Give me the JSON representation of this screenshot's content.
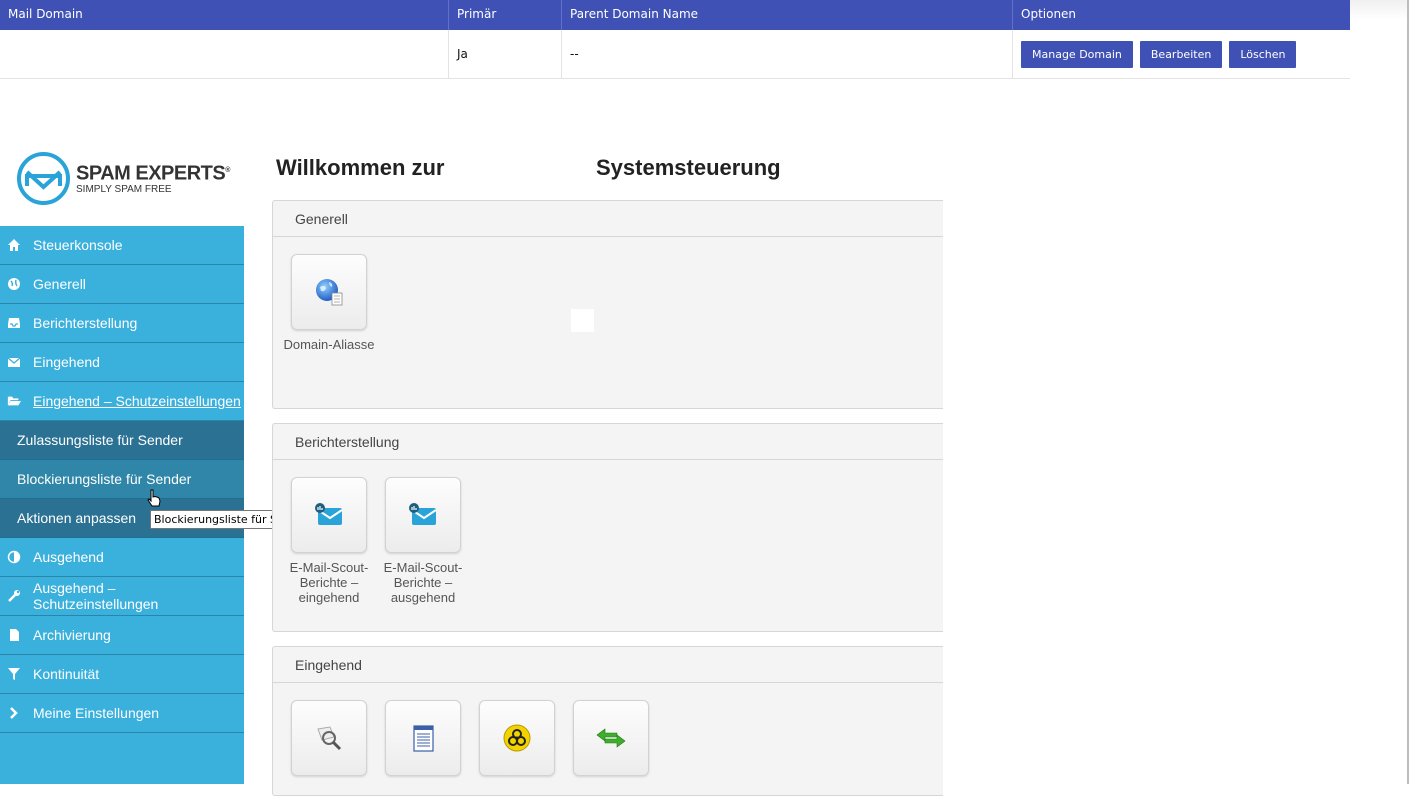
{
  "domain_table": {
    "headers": [
      "Mail Domain",
      "Primär",
      "Parent Domain Name",
      "Optionen"
    ],
    "row": {
      "mail_domain": "",
      "primary": "Ja",
      "parent": "--"
    },
    "buttons": {
      "manage": "Manage Domain",
      "edit": "Bearbeiten",
      "delete": "Löschen"
    }
  },
  "logo": {
    "brand": "SPAM EXPERTS",
    "reg": "®",
    "tagline": "SIMPLY SPAM FREE"
  },
  "sidebar": {
    "items": [
      {
        "label": "Steuerkonsole",
        "icon": "home-icon"
      },
      {
        "label": "Generell",
        "icon": "globe-icon"
      },
      {
        "label": "Berichterstellung",
        "icon": "inbox-icon"
      },
      {
        "label": "Eingehend",
        "icon": "envelope-icon"
      },
      {
        "label": "Eingehend – Schutzeinstellungen",
        "icon": "folder-open-icon"
      }
    ],
    "sub_items": [
      {
        "label": "Zulassungsliste für Sender"
      },
      {
        "label": "Blockierungsliste für Sender"
      },
      {
        "label": "Aktionen anpassen"
      }
    ],
    "items_after": [
      {
        "label": "Ausgehend",
        "icon": "adjust-icon"
      },
      {
        "label": "Ausgehend – Schutzeinstellungen",
        "icon": "wrench-icon"
      },
      {
        "label": "Archivierung",
        "icon": "file-icon"
      },
      {
        "label": "Kontinuität",
        "icon": "filter-icon"
      },
      {
        "label": "Meine Einstellungen",
        "icon": "chevron-right-icon"
      }
    ]
  },
  "tooltip": "Blockierungsliste für Sender",
  "main": {
    "title_part1": "Willkommen zur",
    "title_part2": "Systemsteuerung",
    "panels": {
      "generell": {
        "title": "Generell",
        "tiles": [
          {
            "label": "Domain-Aliasse",
            "icon": "globe-document-icon"
          }
        ]
      },
      "bericht": {
        "title": "Berichterstellung",
        "tiles": [
          {
            "label": "E-Mail-Scout-Berichte – eingehend",
            "icon": "mail-report-icon"
          },
          {
            "label": "E-Mail-Scout-Berichte – ausgehend",
            "icon": "mail-report-icon"
          }
        ]
      },
      "eingehend": {
        "title": "Eingehend",
        "tiles": [
          {
            "label": "",
            "icon": "magnifier-icon"
          },
          {
            "label": "",
            "icon": "report-list-icon"
          },
          {
            "label": "",
            "icon": "biohazard-icon"
          },
          {
            "label": "",
            "icon": "arrows-exchange-icon"
          }
        ]
      }
    }
  },
  "colors": {
    "table_header": "#3f51b5",
    "sidebar": "#3ab0dd",
    "sidebar_active": "#2a7193",
    "logo": "#29a3d8"
  }
}
